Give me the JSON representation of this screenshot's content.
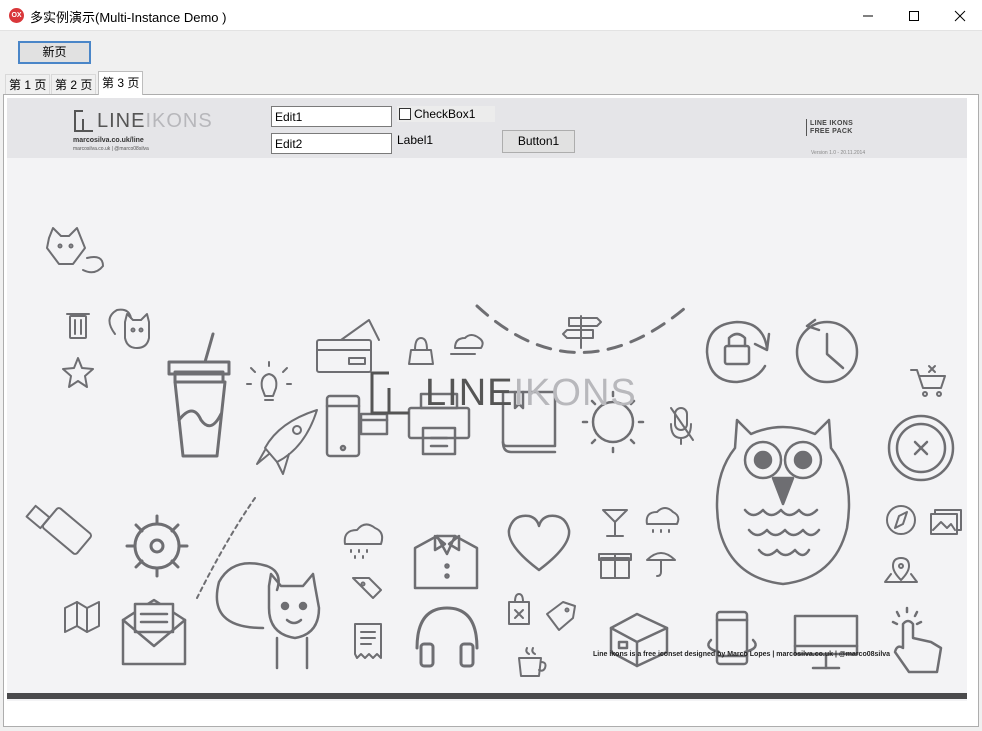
{
  "window": {
    "icon_text": "OX",
    "title": "多实例演示(Multi-Instance Demo )"
  },
  "toolbar": {
    "new_page_label": "新页"
  },
  "tabs": [
    {
      "label": "第 1 页"
    },
    {
      "label": "第 2 页"
    },
    {
      "label": "第 3 页"
    }
  ],
  "form": {
    "edit1_value": "Edit1",
    "edit2_value": "Edit2",
    "checkbox_label": "CheckBox1",
    "checkbox_checked": false,
    "label1": "Label1",
    "button1_label": "Button1"
  },
  "artwork": {
    "header_logo_dark": "LINE",
    "header_logo_light": "IKONS",
    "header_url": "marcosilva.co.uk/line",
    "header_url_small": "marcosilva.co.uk | @marco08silva",
    "header_right_line1": "LINE IKONS",
    "header_right_line2": "FREE PACK",
    "version": "Version 1.0 - 20.11.2014",
    "center_logo_dark": "LINE",
    "center_logo_light": "IKONS",
    "credit": "Line ikons is a free iconset designed by Marco Lopes | marcosilva.co.uk | @marco08silva"
  },
  "colors": {
    "icon_stroke": "#6e6e72",
    "canvas_bg": "#f3f3f5",
    "accent_border": "#4a86c8"
  }
}
